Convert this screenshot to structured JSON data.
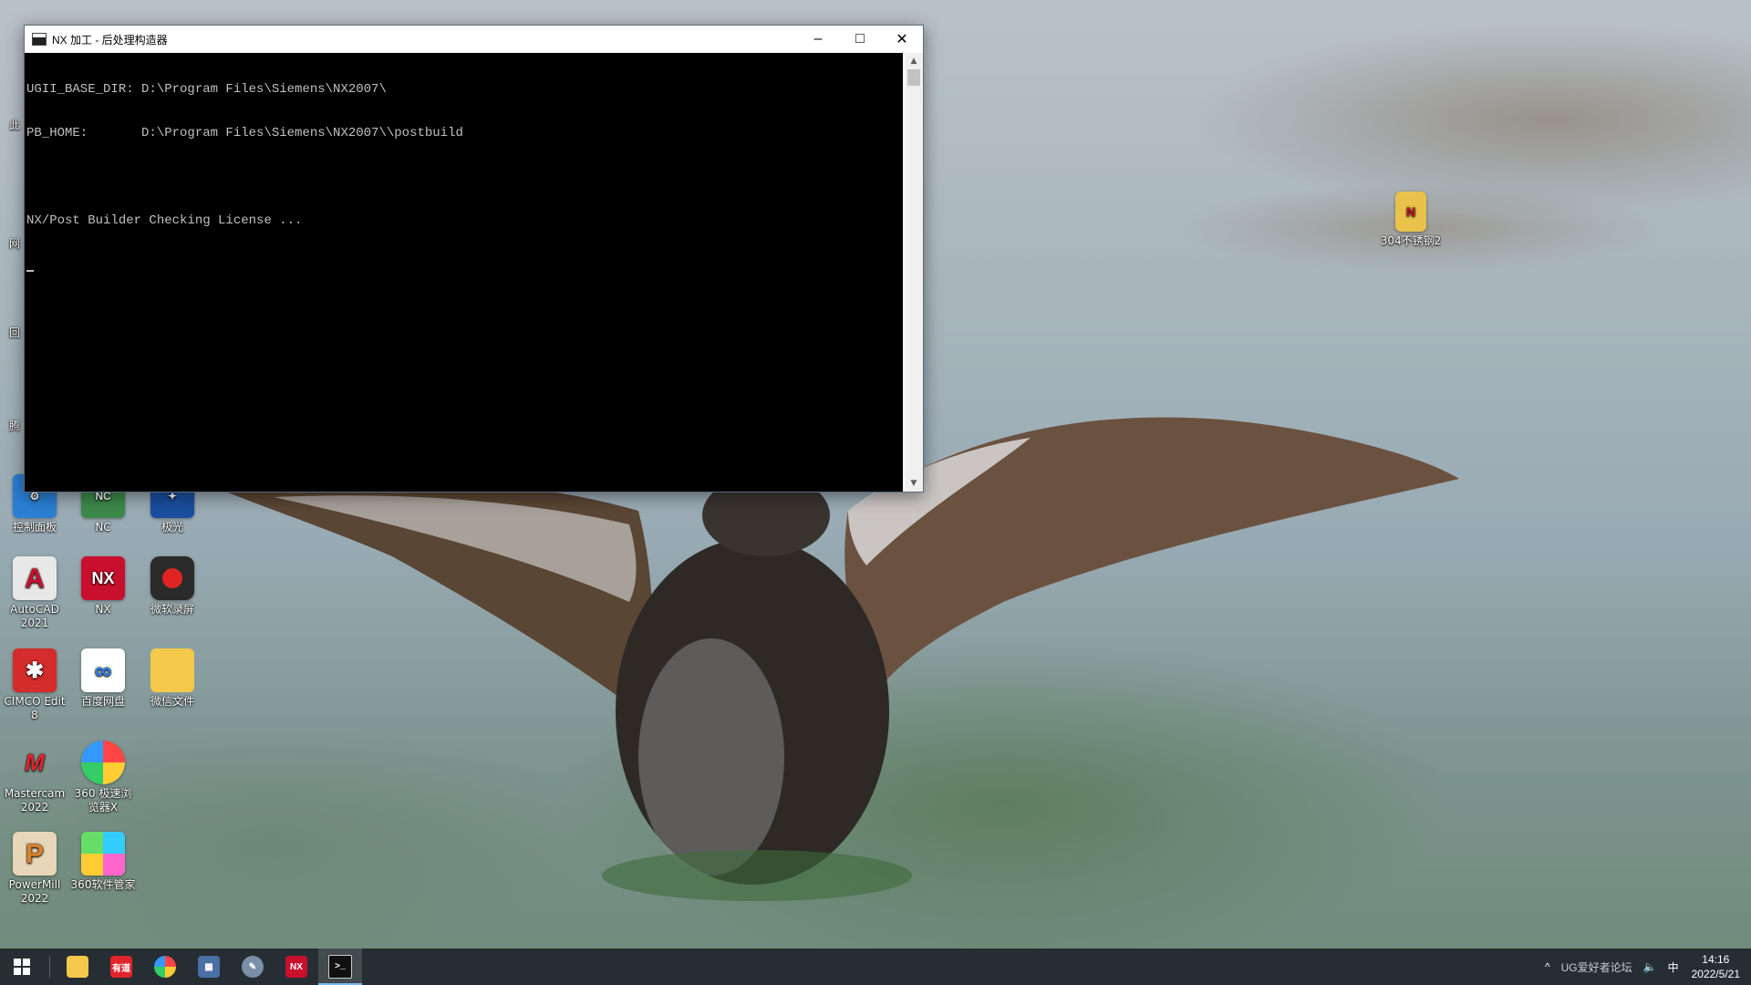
{
  "window": {
    "title": "NX 加工 - 后处理构造器",
    "console_lines": [
      "UGII_BASE_DIR: D:\\Program Files\\Siemens\\NX2007\\",
      "PB_HOME:       D:\\Program Files\\Siemens\\NX2007\\\\postbuild",
      "",
      "NX/Post Builder Checking License ..."
    ]
  },
  "desktop": {
    "icons": [
      {
        "label": "控制面板",
        "icon": "control-panel-icon"
      },
      {
        "label": "NC",
        "icon": "nc-icon"
      },
      {
        "label": "极光",
        "icon": "aurora-icon"
      },
      {
        "label": "AutoCAD 2021",
        "icon": "autocad-icon"
      },
      {
        "label": "NX",
        "icon": "nx-icon"
      },
      {
        "label": "微软录屏",
        "icon": "screen-recorder-icon"
      },
      {
        "label": "CIMCO Edit 8",
        "icon": "cimco-icon"
      },
      {
        "label": "百度网盘",
        "icon": "baidu-netdisk-icon"
      },
      {
        "label": "微信文件",
        "icon": "folder-icon"
      },
      {
        "label": "Mastercam 2022",
        "icon": "mastercam-icon"
      },
      {
        "label": "360 极速浏览器X",
        "icon": "browser-360-icon"
      },
      {
        "label": "PowerMill 2022",
        "icon": "powermill-icon"
      },
      {
        "label": "360软件管家",
        "icon": "software-manager-360-icon"
      },
      {
        "label": "304不锈钢2",
        "icon": "archive-file-icon"
      }
    ],
    "partial_labels": [
      "此",
      "网",
      "回",
      "腾"
    ]
  },
  "taskbar": {
    "items": [
      {
        "name": "start",
        "icon": "windows-start-icon"
      },
      {
        "name": "file-explorer",
        "icon": "folder-icon"
      },
      {
        "name": "youdao",
        "icon": "youdao-icon",
        "text": "有道"
      },
      {
        "name": "browser-360",
        "icon": "browser-360-icon"
      },
      {
        "name": "calculator",
        "icon": "calculator-icon"
      },
      {
        "name": "paint",
        "icon": "paint-icon"
      },
      {
        "name": "nx",
        "icon": "nx-icon",
        "text": "NX"
      },
      {
        "name": "console",
        "icon": "console-icon",
        "active": true
      }
    ],
    "tray": {
      "expand": "^",
      "ime": "中",
      "clock_time": "14:16",
      "clock_date": "2022/5/21",
      "watermark": "UG爱好者论坛"
    }
  },
  "colors": {
    "console_bg": "#000000",
    "console_fg": "#c0c0c0",
    "taskbar_bg": "#20262c",
    "accent": "#76b9ed"
  }
}
